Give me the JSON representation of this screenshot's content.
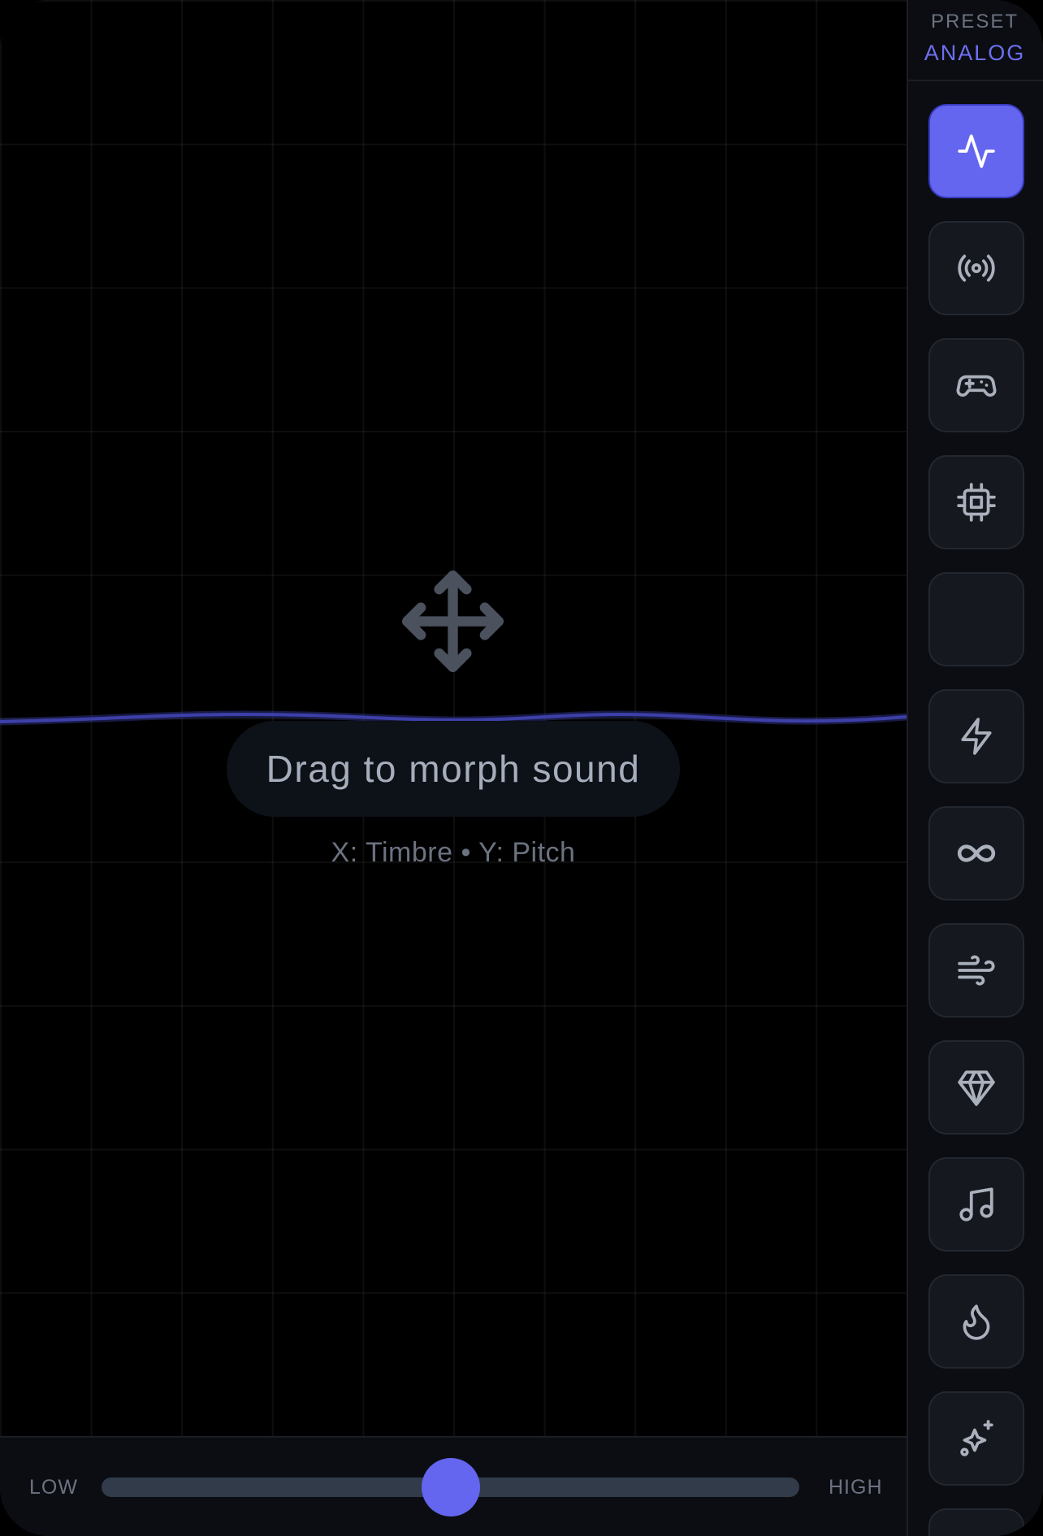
{
  "pad": {
    "hint": "Drag to morph sound",
    "axes": "X: Timbre • Y: Pitch"
  },
  "slider": {
    "low_label": "LOW",
    "high_label": "HIGH",
    "value": 0.5
  },
  "preset": {
    "label": "PRESET",
    "value": "ANALOG"
  },
  "presets": [
    {
      "icon": "activity-icon",
      "active": true
    },
    {
      "icon": "broadcast-icon",
      "active": false
    },
    {
      "icon": "gamepad-icon",
      "active": false
    },
    {
      "icon": "cpu-chip-icon",
      "active": false
    },
    {
      "icon": "empty-icon",
      "active": false
    },
    {
      "icon": "lightning-bolt-icon",
      "active": false
    },
    {
      "icon": "infinity-icon",
      "active": false
    },
    {
      "icon": "wind-icon",
      "active": false
    },
    {
      "icon": "gem-icon",
      "active": false
    },
    {
      "icon": "music-note-icon",
      "active": false
    },
    {
      "icon": "flame-icon",
      "active": false
    },
    {
      "icon": "sparkles-icon",
      "active": false
    }
  ],
  "colors": {
    "accent": "#6466f0",
    "background": "#000000",
    "panel": "#0b0d12",
    "tile": "#15181e",
    "muted_text": "#6b7280"
  }
}
